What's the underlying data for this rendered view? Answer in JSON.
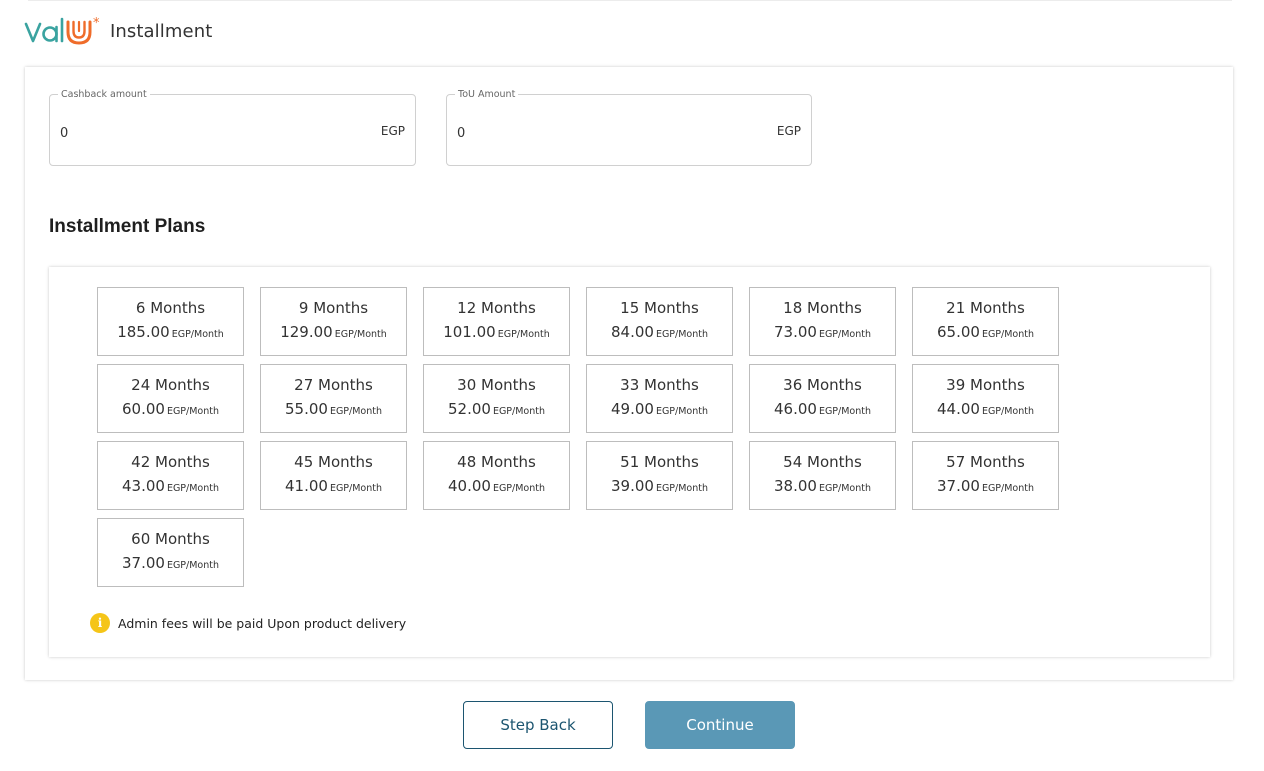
{
  "colors": {
    "brand_teal": "#3aa3a0",
    "brand_orange": "#ef6c2a",
    "primary_button": "#5a98b6",
    "secondary_border": "#1c5570",
    "info_icon": "#f5c518"
  },
  "header": {
    "logo_text": "valU",
    "title": "Installment"
  },
  "fields": {
    "cashback": {
      "label": "Cashback amount",
      "value": "0",
      "suffix": "EGP"
    },
    "tou": {
      "label": "ToU Amount",
      "value": "0",
      "suffix": "EGP"
    }
  },
  "plans_title": "Installment Plans",
  "plans": [
    {
      "months": "6 Months",
      "amount": "185.00",
      "unit": "EGP/Month"
    },
    {
      "months": "9 Months",
      "amount": "129.00",
      "unit": "EGP/Month"
    },
    {
      "months": "12 Months",
      "amount": "101.00",
      "unit": "EGP/Month"
    },
    {
      "months": "15 Months",
      "amount": "84.00",
      "unit": "EGP/Month"
    },
    {
      "months": "18 Months",
      "amount": "73.00",
      "unit": "EGP/Month"
    },
    {
      "months": "21 Months",
      "amount": "65.00",
      "unit": "EGP/Month"
    },
    {
      "months": "24 Months",
      "amount": "60.00",
      "unit": "EGP/Month"
    },
    {
      "months": "27 Months",
      "amount": "55.00",
      "unit": "EGP/Month"
    },
    {
      "months": "30 Months",
      "amount": "52.00",
      "unit": "EGP/Month"
    },
    {
      "months": "33 Months",
      "amount": "49.00",
      "unit": "EGP/Month"
    },
    {
      "months": "36 Months",
      "amount": "46.00",
      "unit": "EGP/Month"
    },
    {
      "months": "39 Months",
      "amount": "44.00",
      "unit": "EGP/Month"
    },
    {
      "months": "42 Months",
      "amount": "43.00",
      "unit": "EGP/Month"
    },
    {
      "months": "45 Months",
      "amount": "41.00",
      "unit": "EGP/Month"
    },
    {
      "months": "48 Months",
      "amount": "40.00",
      "unit": "EGP/Month"
    },
    {
      "months": "51 Months",
      "amount": "39.00",
      "unit": "EGP/Month"
    },
    {
      "months": "54 Months",
      "amount": "38.00",
      "unit": "EGP/Month"
    },
    {
      "months": "57 Months",
      "amount": "37.00",
      "unit": "EGP/Month"
    },
    {
      "months": "60 Months",
      "amount": "37.00",
      "unit": "EGP/Month"
    }
  ],
  "note": {
    "icon": "info-icon",
    "icon_glyph": "i",
    "text": "Admin fees will be paid Upon product delivery"
  },
  "buttons": {
    "back": "Step Back",
    "continue": "Continue"
  }
}
